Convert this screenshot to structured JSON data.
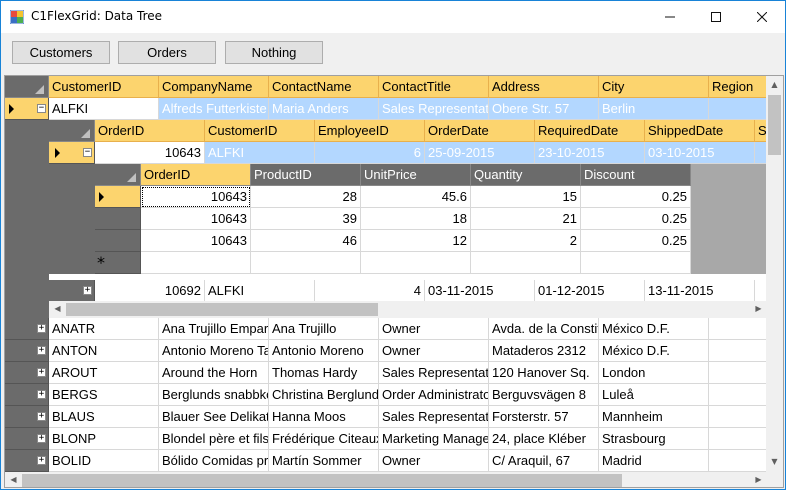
{
  "window": {
    "title": "C1FlexGrid: Data Tree",
    "icon": "grid-app-icon"
  },
  "toolbar": {
    "customers_label": "Customers",
    "orders_label": "Orders",
    "nothing_label": "Nothing"
  },
  "customers_grid": {
    "columns": [
      "CustomerID",
      "CompanyName",
      "ContactName",
      "ContactTitle",
      "Address",
      "City",
      "Region"
    ],
    "selected_row": [
      "ALFKI",
      "Alfreds Futterkiste",
      "Maria Anders",
      "Sales Representative",
      "Obere Str. 57",
      "Berlin",
      ""
    ],
    "rows": [
      [
        "ANATR",
        "Ana Trujillo Emparedados",
        "Ana Trujillo",
        "Owner",
        "Avda. de la Constitución",
        "México D.F.",
        ""
      ],
      [
        "ANTON",
        "Antonio Moreno Taquería",
        "Antonio Moreno",
        "Owner",
        "Mataderos  2312",
        "México D.F.",
        ""
      ],
      [
        "AROUT",
        "Around the Horn",
        "Thomas Hardy",
        "Sales Representative",
        "120 Hanover Sq.",
        "London",
        ""
      ],
      [
        "BERGS",
        "Berglunds snabbköp",
        "Christina Berglund",
        "Order Administrator",
        "Berguvsvägen  8",
        "Luleå",
        ""
      ],
      [
        "BLAUS",
        "Blauer See Delikatessen",
        "Hanna Moos",
        "Sales Representative",
        "Forsterstr. 57",
        "Mannheim",
        ""
      ],
      [
        "BLONP",
        "Blondel père et fils",
        "Frédérique Citeaux",
        "Marketing Manager",
        "24, place Kléber",
        "Strasbourg",
        ""
      ],
      [
        "BOLID",
        "Bólido Comidas preparadas",
        "Martín Sommer",
        "Owner",
        "C/ Araquil, 67",
        "Madrid",
        ""
      ]
    ]
  },
  "orders_grid": {
    "columns": [
      "OrderID",
      "CustomerID",
      "EmployeeID",
      "OrderDate",
      "RequiredDate",
      "ShippedDate",
      "Sh"
    ],
    "selected_row": [
      "10643",
      "ALFKI",
      "6",
      "25-09-2015",
      "23-10-2015",
      "03-10-2015",
      ""
    ],
    "second_row": [
      "10692",
      "ALFKI",
      "4",
      "03-11-2015",
      "01-12-2015",
      "13-11-2015",
      ""
    ]
  },
  "details_grid": {
    "columns": [
      "OrderID",
      "ProductID",
      "UnitPrice",
      "Quantity",
      "Discount"
    ],
    "rows": [
      [
        "10643",
        "28",
        "45.6",
        "15",
        "0.25"
      ],
      [
        "10643",
        "39",
        "18",
        "21",
        "0.25"
      ],
      [
        "10643",
        "46",
        "12",
        "2",
        "0.25"
      ]
    ],
    "new_row_marker": "*"
  }
}
